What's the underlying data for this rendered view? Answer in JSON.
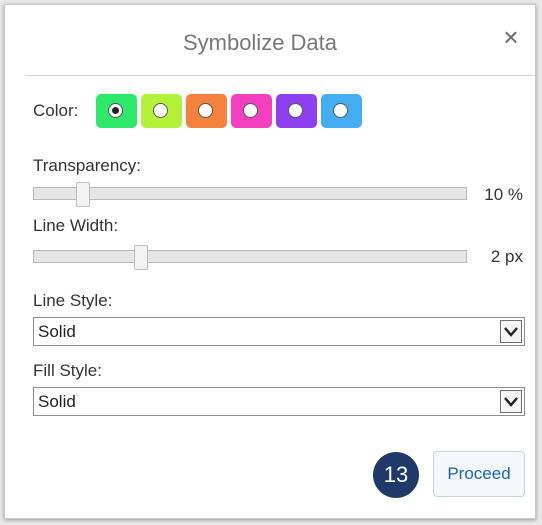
{
  "dialog": {
    "title": "Symbolize Data",
    "close_glyph": "×"
  },
  "color": {
    "label": "Color:",
    "swatches": [
      {
        "color": "#2ee86a",
        "selected": true
      },
      {
        "color": "#b4f23a",
        "selected": false
      },
      {
        "color": "#f5813c",
        "selected": false
      },
      {
        "color": "#f43fbe",
        "selected": false
      },
      {
        "color": "#8e3ff0",
        "selected": false
      },
      {
        "color": "#43aef2",
        "selected": false
      }
    ]
  },
  "transparency": {
    "label": "Transparency:",
    "value": "10 %",
    "fraction": 0.1
  },
  "line_width": {
    "label": "Line Width:",
    "value": "2 px",
    "fraction": 0.24
  },
  "line_style": {
    "label": "Line Style:",
    "selected": "Solid"
  },
  "fill_style": {
    "label": "Fill Style:",
    "selected": "Solid"
  },
  "footer": {
    "step_number": "13",
    "proceed_label": "Proceed"
  }
}
